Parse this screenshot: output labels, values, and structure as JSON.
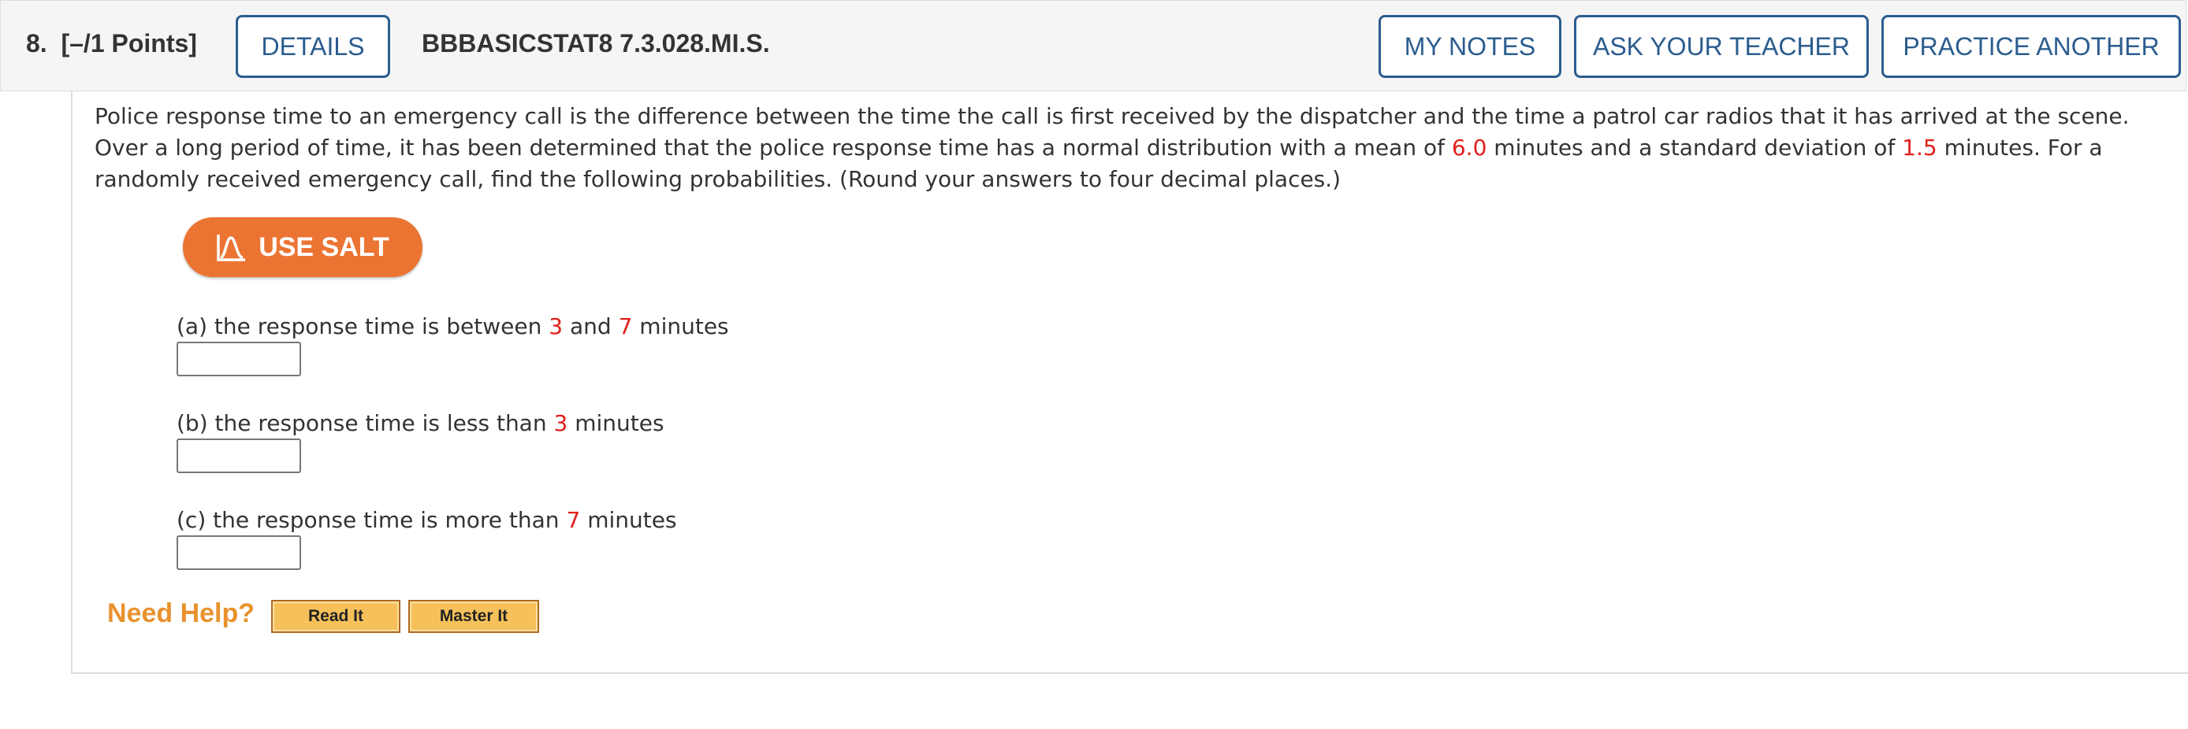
{
  "header": {
    "question_number": "8.",
    "points": "[–/1 Points]",
    "details_label": "DETAILS",
    "problem_code": "BBBASICSTAT8 7.3.028.MI.S.",
    "my_notes_label": "MY NOTES",
    "ask_teacher_label": "ASK YOUR TEACHER",
    "practice_another_label": "PRACTICE ANOTHER"
  },
  "question": {
    "text_1": "Police response time to an emergency call is the difference between the time the call is first received by the dispatcher and the time a patrol car radios that it has arrived at the scene. Over a long period of time, it has been determined that the police response time has a normal distribution with a mean of ",
    "mean": "6.0",
    "text_2": " minutes and a standard deviation of ",
    "sd": "1.5",
    "text_3": " minutes. For a randomly received emergency call, find the following probabilities. (Round your answers to four decimal places.)"
  },
  "salt_button": {
    "label": "USE SALT",
    "icon": "salt-bell-curve-icon"
  },
  "parts": [
    {
      "prefix": "(a) the response time is between ",
      "v1": "3",
      "mid": " and ",
      "v2": "7",
      "suffix": " minutes",
      "answer": ""
    },
    {
      "prefix": "(b) the response time is less than ",
      "v1": "3",
      "suffix": " minutes",
      "answer": ""
    },
    {
      "prefix": "(c) the response time is more than ",
      "v1": "7",
      "suffix": " minutes",
      "answer": ""
    }
  ],
  "help": {
    "need_help_label": "Need Help?",
    "read_it_label": "Read It",
    "master_it_label": "Master It"
  },
  "colors": {
    "accent_blue": "#2b5d8f",
    "value_red": "#e0201c",
    "salt_orange": "#ec7433",
    "need_help_orange": "#e8922e",
    "help_button_fill": "#f6c15a"
  }
}
